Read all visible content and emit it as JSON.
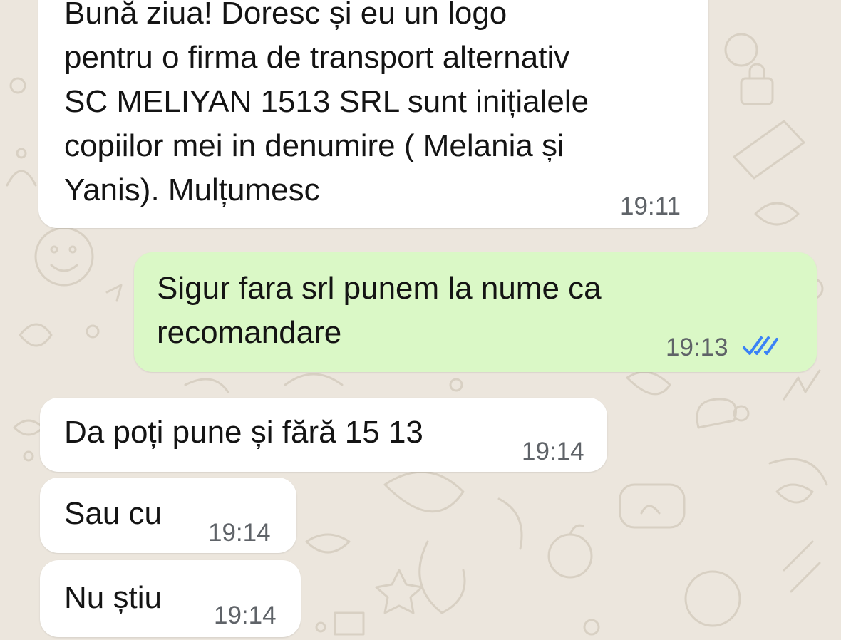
{
  "chat": {
    "messages": [
      {
        "direction": "incoming",
        "text": "Bună ziua! Doresc și eu un logo\npentru o firma de transport alternativ\nSC MELIYAN 1513 SRL sunt inițialele\ncopiilor mei in denumire ( Melania și\nYanis). Mulțumesc",
        "time": "19:11"
      },
      {
        "direction": "outgoing",
        "text": "Sigur fara srl punem la nume ca\nrecomandare",
        "time": "19:13",
        "status": "read",
        "status_icon": "double-check-icon"
      },
      {
        "direction": "incoming",
        "text": "Da poți pune și fără 15 13",
        "time": "19:14"
      },
      {
        "direction": "incoming",
        "text": "Sau cu",
        "time": "19:14"
      },
      {
        "direction": "incoming",
        "text": "Nu știu",
        "time": "19:14"
      }
    ]
  },
  "colors": {
    "background": "#ece6dd",
    "incoming_bubble": "#ffffff",
    "outgoing_bubble": "#daf8c6",
    "read_ticks": "#3b82f6"
  }
}
